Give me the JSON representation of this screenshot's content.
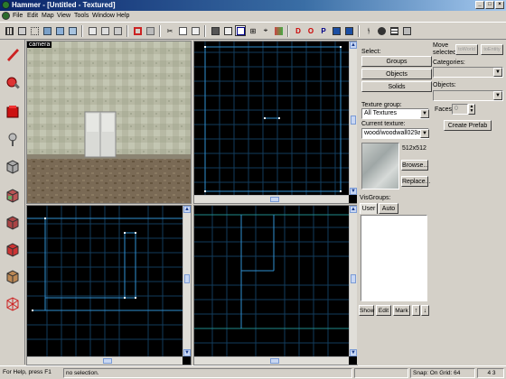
{
  "window": {
    "title": "Hammer - [Untitled - Textured]"
  },
  "menu": [
    "File",
    "Edit",
    "Map",
    "View",
    "Tools",
    "Window",
    "Help"
  ],
  "viewport_3d": {
    "label": "camera"
  },
  "selection": {
    "label": "Select:",
    "groups": "Groups",
    "objects": "Objects",
    "solids": "Solids"
  },
  "texture": {
    "group_label": "Texture group:",
    "group_value": "All Textures",
    "current_label": "Current texture:",
    "current_value": "wood/woodwall029a",
    "size": "512x512",
    "browse": "Browse...",
    "replace": "Replace..."
  },
  "move_selected": {
    "label": "Move selected:",
    "tobworld": "toWorld",
    "toentity": "toEntity",
    "categories": "Categories:",
    "objects": "Objects:",
    "faces_label": "Faces:",
    "faces_value": "0",
    "create_prefab": "Create Prefab"
  },
  "visgroups": {
    "label": "VisGroups:",
    "tab_user": "User",
    "tab_auto": "Auto",
    "show": "Show",
    "edit": "Edit",
    "mark": "Mark"
  },
  "status": {
    "help": "For Help, press F1",
    "selection": "no selection.",
    "snap": "Snap: On Grid: 64",
    "zoom": "4 3"
  },
  "colors": {
    "grid": "#123c5c",
    "grid_major": "#1f6a8a",
    "brush": "#2f8fd0",
    "vertex": "#ffffff"
  }
}
